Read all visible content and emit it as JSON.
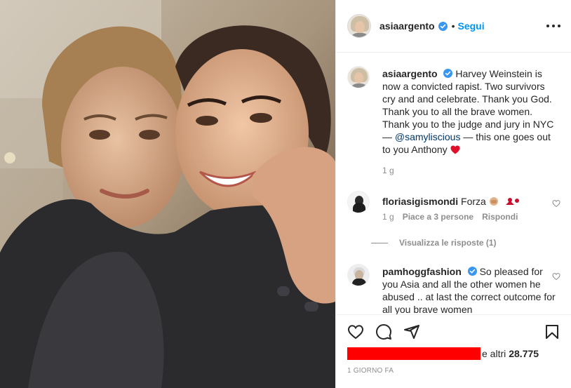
{
  "post": {
    "username": "asiaargento",
    "follow_label": "Segui",
    "separator": "•"
  },
  "caption": {
    "username": "asiaargento",
    "text": "Harvey Weinstein is now a convicted rapist. Two survivors cry and and celebrate. Thank you God. Thank you to all the brave women. Thank you to the judge and jury in NYC —",
    "mention": "@samyliscious",
    "text_after": "— this one goes out to you Anthony",
    "emoji": "red-heart",
    "time": "1 g"
  },
  "comments": [
    {
      "username": "floriasigismondi",
      "text": "Forza",
      "time": "1 g",
      "likes": "Piace a 3 persone",
      "reply": "Rispondi",
      "view_replies": "Visualizza le risposte (1)"
    },
    {
      "username": "pamhoggfashion",
      "text": "So pleased for you Asia and all the other women he abused .. at last the correct outcome for all you brave women"
    }
  ],
  "likes": {
    "prefix": "e altri",
    "count": "28.775"
  },
  "date": "1 GIORNO FA",
  "colors": {
    "accent": "#0095f6",
    "verified": "#3897f0",
    "redaction": "#ff0000",
    "muted": "#8e8e8e"
  },
  "icons": [
    "verified-badge-icon",
    "more-options-icon",
    "heart-icon",
    "comment-icon",
    "share-icon",
    "bookmark-icon"
  ]
}
